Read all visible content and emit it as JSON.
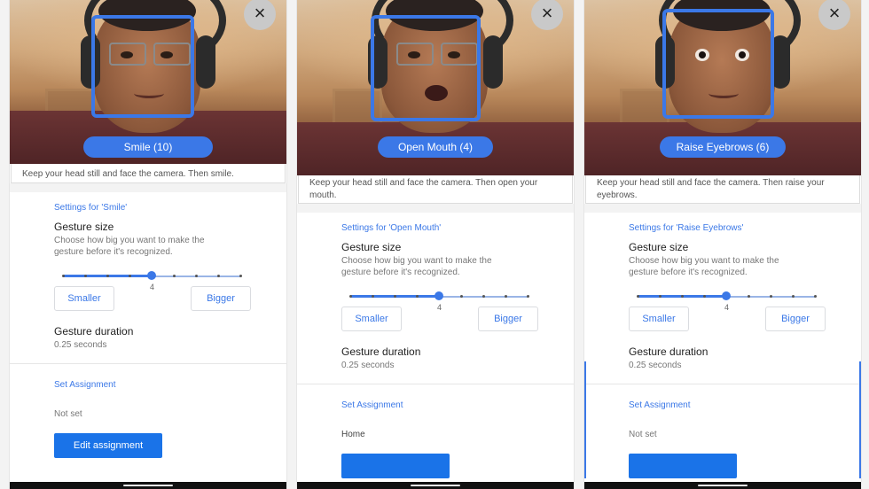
{
  "close_glyph": "×",
  "panels": [
    {
      "gesture_label": "Smile (10)",
      "instruction": "Keep your head still and face the camera. Then smile.",
      "settings_title": "Settings for 'Smile'",
      "gesture_size_label": "Gesture size",
      "gesture_size_desc": "Choose how big you want to make the gesture before it's recognized.",
      "slider_value": "4",
      "smaller_label": "Smaller",
      "bigger_label": "Bigger",
      "duration_label": "Gesture duration",
      "duration_value": "0.25 seconds",
      "assignment_title": "Set Assignment",
      "assignment_value": "Not set",
      "edit_label": "Edit assignment"
    },
    {
      "gesture_label": "Open Mouth (4)",
      "instruction": "Keep your head still and face the camera. Then open your mouth.",
      "settings_title": "Settings for 'Open Mouth'",
      "gesture_size_label": "Gesture size",
      "gesture_size_desc": "Choose how big you want to make the gesture before it's recognized.",
      "slider_value": "4",
      "smaller_label": "Smaller",
      "bigger_label": "Bigger",
      "duration_label": "Gesture duration",
      "duration_value": "0.25 seconds",
      "assignment_title": "Set Assignment",
      "assignment_value": "Home",
      "edit_label": ""
    },
    {
      "gesture_label": "Raise Eyebrows (6)",
      "instruction": "Keep your head still and face the camera. Then raise your eyebrows.",
      "settings_title": "Settings for 'Raise Eyebrows'",
      "gesture_size_label": "Gesture size",
      "gesture_size_desc": "Choose how big you want to make the gesture before it's recognized.",
      "slider_value": "4",
      "smaller_label": "Smaller",
      "bigger_label": "Bigger",
      "duration_label": "Gesture duration",
      "duration_value": "0.25 seconds",
      "assignment_title": "Set Assignment",
      "assignment_value": "Not set",
      "edit_label": ""
    }
  ],
  "slider": {
    "steps": 9,
    "selected_fraction": 0.5
  },
  "colors": {
    "accent": "#3b78e7",
    "button": "#1a73e8"
  }
}
